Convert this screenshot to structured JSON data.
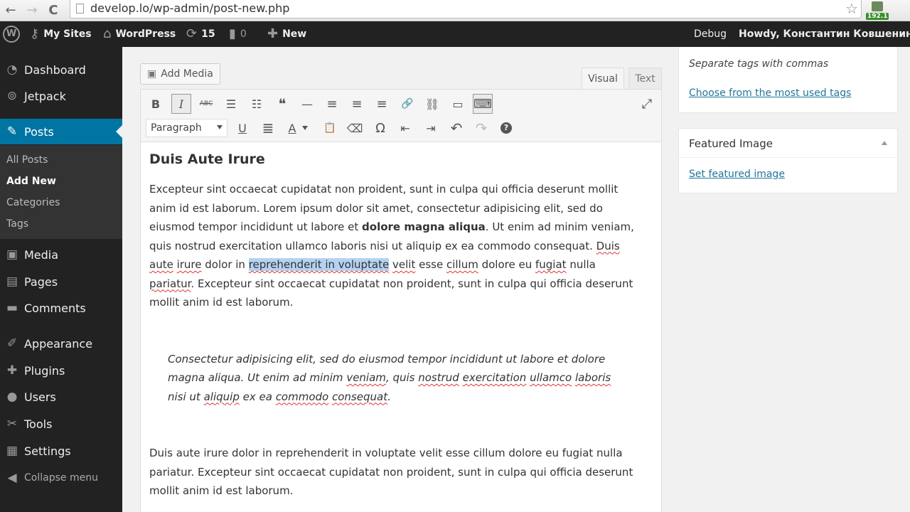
{
  "browser": {
    "url": "develop.lo/wp-admin/post-new.php",
    "ext_badge": "192.1",
    "back_glyph": "←",
    "forward_glyph": "→",
    "reload_glyph": "C",
    "star_glyph": "☆"
  },
  "adminbar": {
    "wp_glyph": "W",
    "my_sites": "My Sites",
    "site_name": "WordPress",
    "updates_count": "15",
    "comments_count": "0",
    "new_label": "New",
    "debug": "Debug",
    "howdy": "Howdy, Константин Ковшенин"
  },
  "sidebar": {
    "items": [
      {
        "label": "Dashboard",
        "icon": "dashboard-icon",
        "glyph": "◔"
      },
      {
        "label": "Jetpack",
        "icon": "jetpack-icon",
        "glyph": "⊚"
      },
      {
        "label": "Posts",
        "icon": "pin-icon",
        "glyph": "✎"
      },
      {
        "label": "Media",
        "icon": "media-icon",
        "glyph": "▣"
      },
      {
        "label": "Pages",
        "icon": "pages-icon",
        "glyph": "▤"
      },
      {
        "label": "Comments",
        "icon": "comments-icon",
        "glyph": "▬"
      },
      {
        "label": "Appearance",
        "icon": "appearance-icon",
        "glyph": "✐"
      },
      {
        "label": "Plugins",
        "icon": "plugins-icon",
        "glyph": "✚"
      },
      {
        "label": "Users",
        "icon": "users-icon",
        "glyph": "●"
      },
      {
        "label": "Tools",
        "icon": "tools-icon",
        "glyph": "✂"
      },
      {
        "label": "Settings",
        "icon": "settings-icon",
        "glyph": "▦"
      },
      {
        "label": "Collapse menu",
        "icon": "collapse-icon",
        "glyph": "◀"
      }
    ],
    "submenu": [
      "All Posts",
      "Add New",
      "Categories",
      "Tags"
    ]
  },
  "editor": {
    "add_media": "Add Media",
    "tab_visual": "Visual",
    "tab_text": "Text",
    "format_select": "Paragraph",
    "toolbar_glyphs": {
      "bold": "B",
      "italic": "I",
      "strike": "ABC",
      "bullets": "☰",
      "numbers": "☷",
      "quote": "❝",
      "hr": "—",
      "align_left": "≡",
      "align_center": "≡",
      "align_right": "≡",
      "link": "🔗",
      "unlink": "⛓",
      "more": "▭",
      "kitchen_sink": "⌨",
      "fullscreen": "⤢",
      "underline": "U",
      "justify": "≣",
      "text_color": "A",
      "paste_text": "📋",
      "clear_format": "⌫",
      "special_char": "Ω",
      "outdent": "⇤",
      "indent": "⇥",
      "undo": "↶",
      "redo": "↷",
      "help": "?"
    },
    "title": "Duis Aute Irure",
    "p1": {
      "line1": "Excepteur sint occaecat cupidatat non proident, sunt in culpa qui officia deserunt mollit anim id est laborum. Lorem ipsum dolor sit amet, consectetur adipisicing elit, sed do eiusmod tempor incididunt ut labore et ",
      "bold": "dolore magna aliqua",
      "line2": ". Ut enim ad minim veniam, quis nostrud exercitation ullamco laboris nisi ut aliquip ex ea commodo consequat. ",
      "w1": "Duis",
      "w2": "aute",
      "w3": "irure",
      "t1": " dolor in ",
      "selected": "reprehenderit in voluptate",
      "t2": " ",
      "w4": "velit",
      "t3": " esse ",
      "w5": "cillum",
      "t4": " dolore eu ",
      "w6": "fugiat",
      "t5": " nulla ",
      "w7": "pariatur",
      "t6": ". Excepteur sint occaecat cupidatat non proident, sunt in culpa qui officia deserunt mollit anim id est laborum."
    },
    "quote": {
      "q1": "Consectetur adipisicing elit, sed do eiusmod tempor incididunt ut labore et dolore magna aliqua. Ut enim ad minim ",
      "w1": "veniam",
      "q2": ", quis ",
      "w2": "nostrud",
      "q3": " ",
      "w3": "exercitation",
      "q4": " ",
      "w4": "ullamco",
      "q5": " ",
      "w5": "laboris",
      "q6": " nisi ut ",
      "w6": "aliquip",
      "q7": " ex ea ",
      "w7": "commodo",
      "q8": " ",
      "w8": "consequat",
      "q9": "."
    },
    "p2": "Duis aute irure dolor in reprehenderit in voluptate velit esse cillum dolore eu fugiat nulla pariatur. Excepteur sint occaecat cupidatat non proident, sunt in culpa qui officia deserunt mollit anim id est laborum."
  },
  "tags_box": {
    "hint": "Separate tags with commas",
    "link": "Choose from the most used tags"
  },
  "featured_box": {
    "title": "Featured Image",
    "link": "Set featured image"
  },
  "colors": {
    "adminbar": "#222222",
    "active_menu": "#0074a2",
    "link": "#21759b",
    "selection": "#b4d3f2"
  }
}
